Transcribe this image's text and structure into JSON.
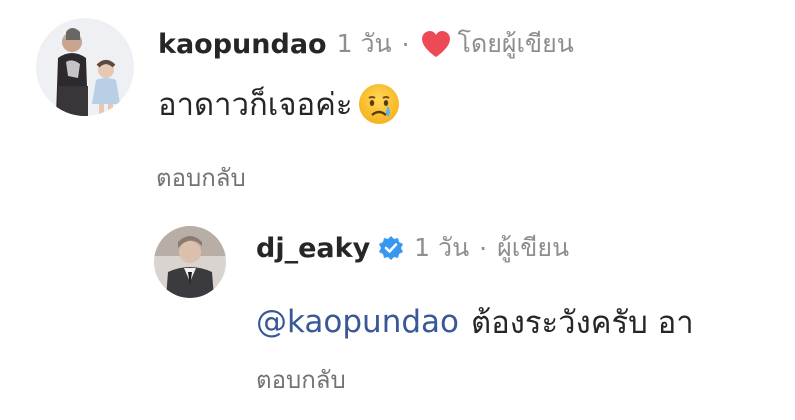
{
  "comments": [
    {
      "username": "kaopundao",
      "time": "1 วัน",
      "separator": "·",
      "liked_by_author_label": "โดยผู้เขียน",
      "text": "อาดาวก็เจอค่ะ",
      "emoji": "crying-face",
      "reply_label": "ตอบกลับ",
      "heart_color": "#ed4956"
    },
    {
      "username": "dj_eaky",
      "verified": true,
      "time": "1 วัน",
      "separator": "·",
      "author_label": "ผู้เขียน",
      "mention": "@kaopundao",
      "text": "ต้องระวังครับ อา",
      "reply_label": "ตอบกลับ",
      "mention_color": "#385898",
      "verified_color": "#3897f0"
    }
  ]
}
